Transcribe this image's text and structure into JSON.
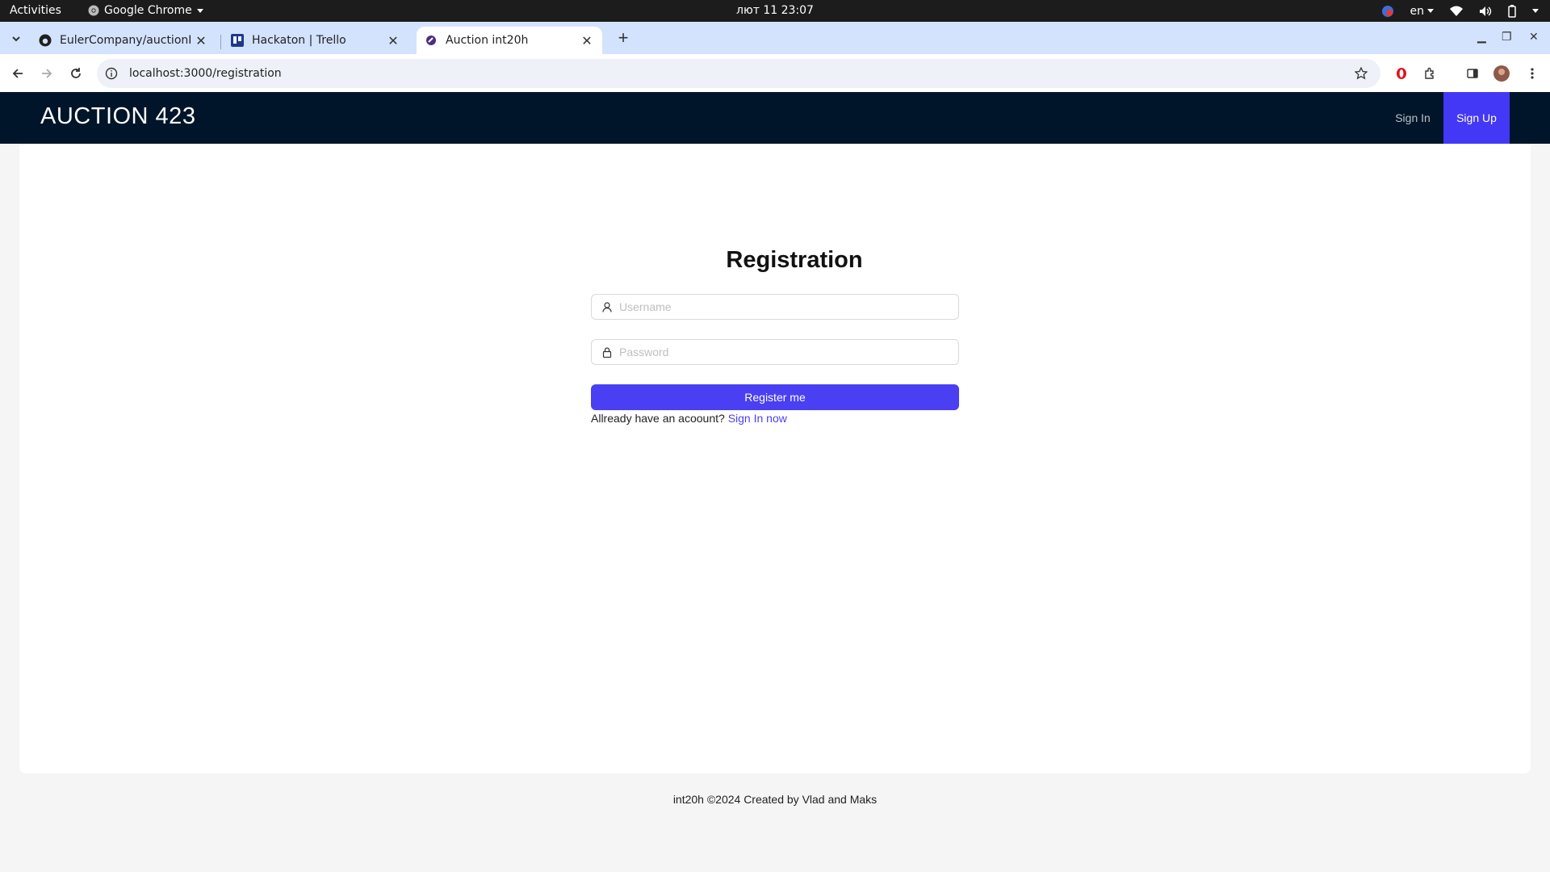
{
  "system": {
    "activities": "Activities",
    "app_name": "Google Chrome",
    "clock": "лют 11  23:07",
    "lang": "en"
  },
  "browser": {
    "tabs": [
      {
        "title": "EulerCompany/auctionI",
        "icon": "github-icon"
      },
      {
        "title": "Hackaton | Trello",
        "icon": "trello-icon"
      },
      {
        "title": "Auction int20h",
        "icon": "auction-favicon",
        "active": true
      }
    ],
    "url": "localhost:3000/registration"
  },
  "header": {
    "brand": "AUCTION 423",
    "sign_in": "Sign In",
    "sign_up": "Sign Up",
    "colors": {
      "background": "#001529",
      "active": "#4338f5"
    }
  },
  "registration": {
    "title": "Registration",
    "username_placeholder": "Username",
    "password_placeholder": "Password",
    "submit_label": "Register me",
    "hint_text": "Allready have an acoount?",
    "hint_link": "Sign In now"
  },
  "footer": {
    "text": "int20h ©2024 Created by Vlad and Maks"
  }
}
